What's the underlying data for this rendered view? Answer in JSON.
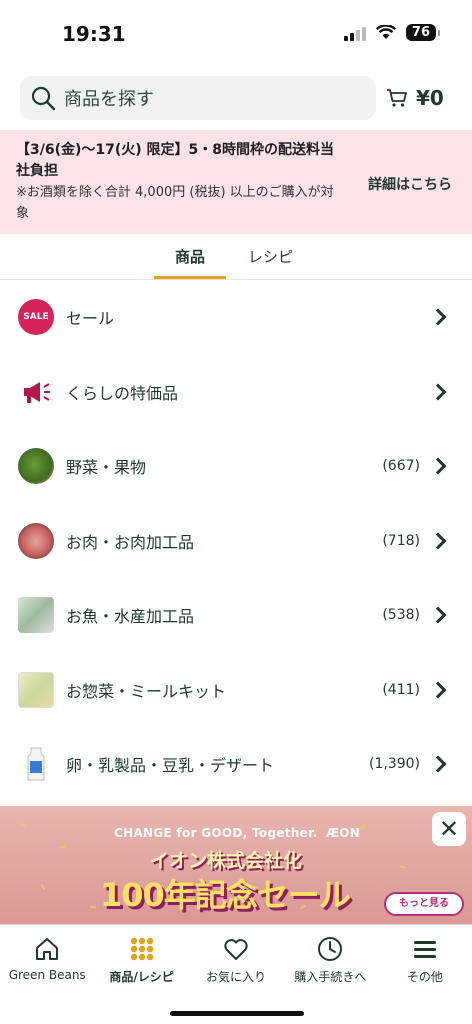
{
  "status": {
    "time": "19:31",
    "battery": "76"
  },
  "search": {
    "placeholder": "商品を探す"
  },
  "cart": {
    "total": "¥0"
  },
  "promo": {
    "title": "【3/6(金)～17(火) 限定】5・8時間枠の配送料当社負担",
    "note": "※お酒類を除く合計 4,000円 (税抜) 以上のご購入が対象",
    "link": "詳細はこちら"
  },
  "tabs": {
    "products": "商品",
    "recipes": "レシピ"
  },
  "categories": [
    {
      "label": "セール",
      "count": "",
      "icon": "sale-icon"
    },
    {
      "label": "くらしの特価品",
      "count": "",
      "icon": "megaphone-icon"
    },
    {
      "label": "野菜・果物",
      "count": "(667)",
      "icon": "vegetable-icon"
    },
    {
      "label": "お肉・お肉加工品",
      "count": "(718)",
      "icon": "meat-icon"
    },
    {
      "label": "お魚・水産加工品",
      "count": "(538)",
      "icon": "fish-icon"
    },
    {
      "label": "お惣菜・ミールキット",
      "count": "(411)",
      "icon": "deli-icon"
    },
    {
      "label": "卵・乳製品・豆乳・デザート",
      "count": "(1,390)",
      "icon": "milk-icon"
    }
  ],
  "banner": {
    "tagline": "CHANGE for GOOD, Together.",
    "brand": "ÆON",
    "subtitle": "イオン株式会社化",
    "title": "100年記念セール",
    "button": "もっと見る"
  },
  "nav": [
    {
      "label": "Green Beans",
      "icon": "home-icon"
    },
    {
      "label": "商品/レシピ",
      "icon": "grid-icon"
    },
    {
      "label": "お気に入り",
      "icon": "heart-icon"
    },
    {
      "label": "購入手続きへ",
      "icon": "clock-icon"
    },
    {
      "label": "その他",
      "icon": "menu-icon"
    }
  ],
  "colors": {
    "primary": "#1f3a2c",
    "accent": "#e5a21f",
    "promo_bg": "#fbe3e6"
  }
}
